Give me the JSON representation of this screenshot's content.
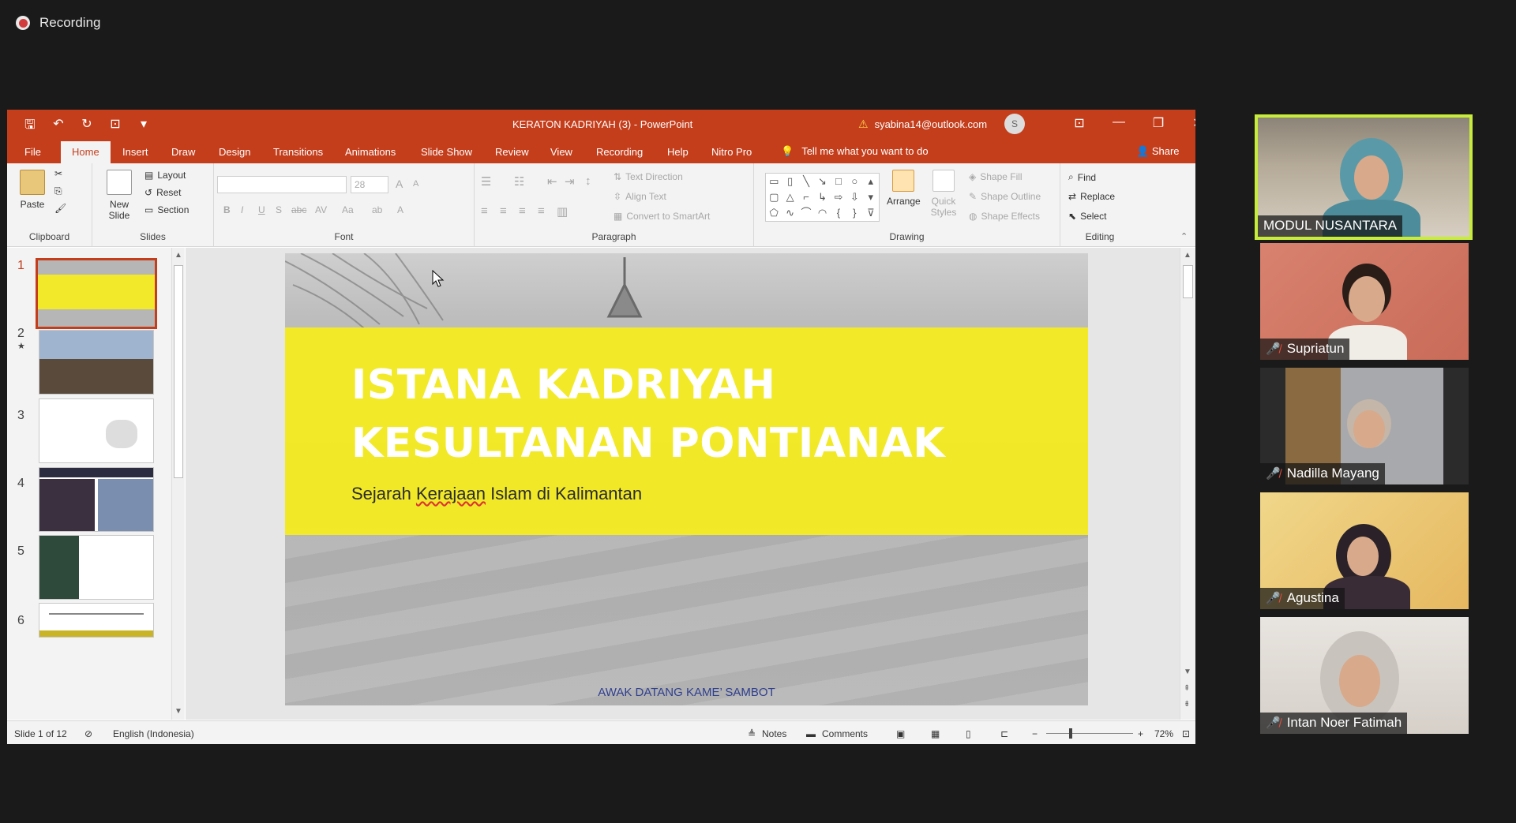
{
  "zoom": {
    "recording_label": "Recording"
  },
  "window": {
    "title": "KERATON KADRIYAH (3)  -  PowerPoint",
    "account": "syabina14@outlook.com",
    "avatar_initial": "S",
    "controls": {
      "ribbon_display": "⊡",
      "minimize": "—",
      "restore": "❐",
      "close": "✕"
    }
  },
  "quick_access": {
    "save": "🖫",
    "undo": "↶",
    "redo": "↻",
    "from_beginning": "⊡",
    "customize": "▾"
  },
  "tabs": [
    "File",
    "Home",
    "Insert",
    "Draw",
    "Design",
    "Transitions",
    "Animations",
    "Slide Show",
    "Review",
    "View",
    "Recording",
    "Help",
    "Nitro Pro"
  ],
  "active_tab": "Home",
  "tell_me": "Tell me what you want to do",
  "share": "Share",
  "ribbon": {
    "clipboard": {
      "label": "Clipboard",
      "paste": "Paste"
    },
    "slides": {
      "label": "Slides",
      "new_slide": "New Slide",
      "layout": "Layout",
      "reset": "Reset",
      "section": "Section"
    },
    "font": {
      "label": "Font",
      "size": "28",
      "bold": "B",
      "italic": "I",
      "underline": "U",
      "shadow": "S",
      "strike": "abc",
      "spacing": "AV",
      "case": "Aa",
      "grow": "A",
      "shrink": "A"
    },
    "paragraph": {
      "label": "Paragraph",
      "text_direction": "Text Direction",
      "align_text": "Align Text",
      "convert_smartart": "Convert to SmartArt"
    },
    "drawing": {
      "label": "Drawing",
      "arrange": "Arrange",
      "quick_styles": "Quick Styles",
      "shape_fill": "Shape Fill",
      "shape_outline": "Shape Outline",
      "shape_effects": "Shape Effects"
    },
    "editing": {
      "label": "Editing",
      "find": "Find",
      "replace": "Replace",
      "select": "Select"
    }
  },
  "thumbnails": [
    {
      "num": "1",
      "marker": ""
    },
    {
      "num": "2",
      "marker": "★"
    },
    {
      "num": "3",
      "marker": ""
    },
    {
      "num": "4",
      "marker": ""
    },
    {
      "num": "5",
      "marker": ""
    },
    {
      "num": "6",
      "marker": ""
    }
  ],
  "slide": {
    "title": "ISTANA KADRIYAH KESULTANAN PONTIANAK",
    "subtitle_prefix": "Sejarah ",
    "subtitle_underlined": "Kerajaan",
    "subtitle_suffix": " Islam di Kalimantan",
    "footer": "AWAK DATANG KAME’ SAMBOT",
    "band_color": "#f6ee1e"
  },
  "status": {
    "slide_count": "Slide 1 of 12",
    "language": "English (Indonesia)",
    "notes": "Notes",
    "comments": "Comments",
    "zoom": "72%"
  },
  "participants": [
    {
      "name": "MODUL NUSANTARA",
      "muted": false,
      "active_speaker": true
    },
    {
      "name": "Supriatun",
      "muted": true,
      "active_speaker": false
    },
    {
      "name": "Nadilla Mayang",
      "muted": true,
      "active_speaker": false
    },
    {
      "name": "Agustina",
      "muted": true,
      "active_speaker": false
    },
    {
      "name": "Intan Noer Fatimah",
      "muted": true,
      "active_speaker": false
    }
  ]
}
